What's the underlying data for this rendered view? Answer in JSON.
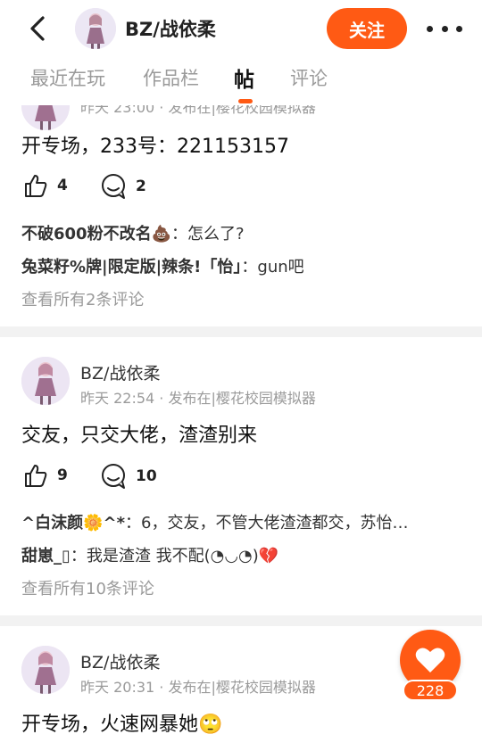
{
  "header": {
    "title": "BZ/战依柔",
    "follow_label": "关注",
    "back_icon": "chevron-left-icon",
    "more_icon": "more-dots-icon"
  },
  "tabs": [
    {
      "label": "最近在玩"
    },
    {
      "label": "作品栏"
    },
    {
      "label": "帖"
    },
    {
      "label": "评论"
    }
  ],
  "accent_color": "#ff5a14",
  "posts": [
    {
      "meta": "昨天 23:00 · 发布在|樱花校园模拟器",
      "text": "开专场，233号：221153157",
      "likes": "4",
      "comments_count": "2",
      "comments": [
        {
          "name": "不破600粉不改名💩",
          "sep": "：",
          "text": "怎么了?"
        },
        {
          "name": "兔菜籽%牌|限定版|辣条!「怡」",
          "sep": "：",
          "text": "gun吧"
        }
      ],
      "view_all": "查看所有2条评论"
    },
    {
      "author": "BZ/战依柔",
      "meta": "昨天 22:54 · 发布在|樱花校园模拟器",
      "text": "交友，只交大佬，渣渣别来",
      "likes": "9",
      "comments_count": "10",
      "comments": [
        {
          "name": "^白沫颜🌼^*",
          "sep": "：",
          "text": "6，交友，不管大佬渣渣都交，苏怡…"
        },
        {
          "name": "甜崽_▯",
          "sep": "：",
          "text": "我是渣渣 我不配(◔◡◔)💔"
        }
      ],
      "view_all": "查看所有10条评论"
    },
    {
      "author": "BZ/战依柔",
      "meta": "昨天 20:31 · 发布在|樱花校园模拟器",
      "text": "开专场，火速网暴她🙄"
    }
  ],
  "floating_like": {
    "count": "228",
    "icon": "heart-icon"
  }
}
